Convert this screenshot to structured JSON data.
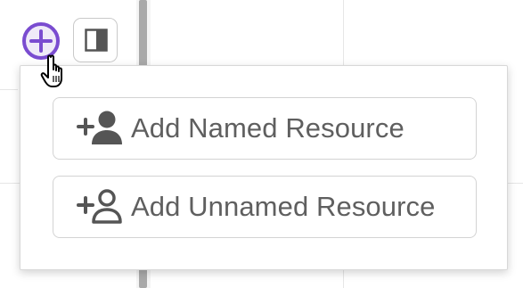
{
  "toolbar": {
    "add_icon": "plus-circle-icon",
    "panel_icon": "sidebar-panel-icon"
  },
  "add_menu": {
    "options": [
      {
        "label": "Add Named Resource",
        "icon": "add-user-filled-icon"
      },
      {
        "label": "Add Unnamed Resource",
        "icon": "add-user-outline-icon"
      }
    ]
  },
  "colors": {
    "accent": "#7a4cd0",
    "accent_fill": "#efeaf8",
    "text": "#5f5f5f",
    "border": "#d3d3d3"
  },
  "cursor": "hand-pointer-icon"
}
